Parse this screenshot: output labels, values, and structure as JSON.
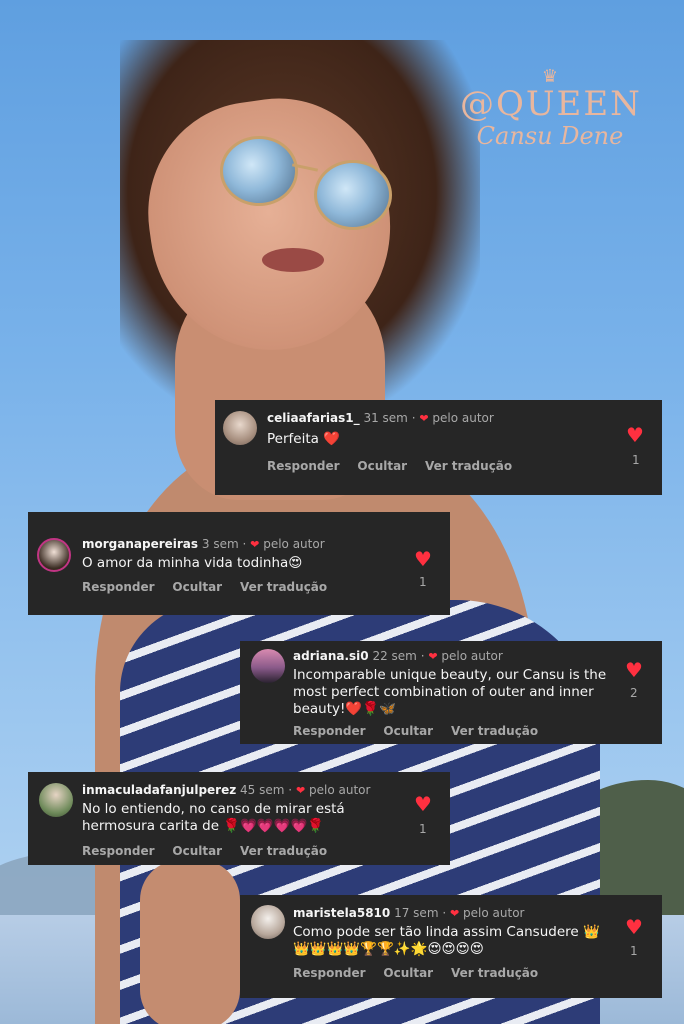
{
  "watermark": {
    "crown": "♛",
    "line1": "@QUEEN",
    "line2": "Cansu Dene"
  },
  "labels": {
    "by_author": "pelo autor",
    "reply": "Responder",
    "hide": "Ocultar",
    "translate": "Ver tradução"
  },
  "comments": [
    {
      "user": "celiaafarias1_",
      "time": "31 sem",
      "text": "Perfeita ❤️",
      "likes": "1"
    },
    {
      "user": "morganapereiras",
      "time": "3 sem",
      "text": "O amor da minha vida todinha😍",
      "likes": "1"
    },
    {
      "user": "adriana.si0",
      "time": "22 sem",
      "text": "Incomparable unique beauty, our Cansu is the most perfect combination of outer and inner beauty!❤️🌹🦋",
      "likes": "2"
    },
    {
      "user": "inmaculadafanjulperez",
      "time": "45 sem",
      "text": "No lo entiendo, no canso de mirar está hermosura carita de 🌹💗💗💗💗🌹",
      "likes": "1"
    },
    {
      "user": "maristela5810",
      "time": "17 sem",
      "text": "Como pode ser tão linda assim Cansudere 👑👑👑👑👑🏆🏆✨🌟😍😍😍😍",
      "likes": "1"
    }
  ],
  "colors": {
    "card_bg": "#262626",
    "heart": "#ff3040",
    "meta": "#a8a8a8"
  }
}
